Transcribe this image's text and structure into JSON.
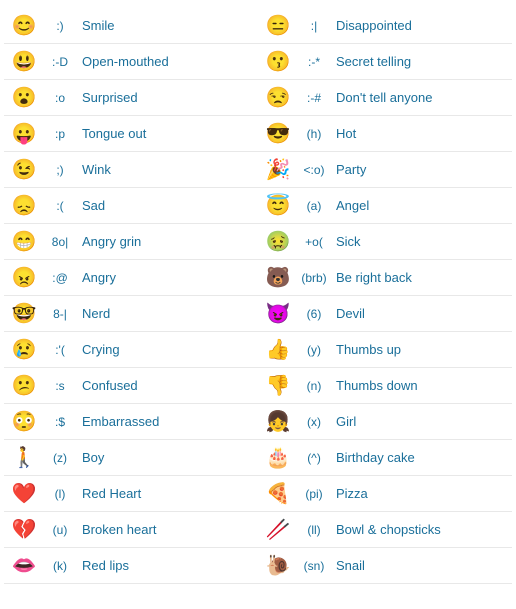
{
  "left": [
    {
      "emoji": "😊",
      "code": ":)",
      "name": "Smile"
    },
    {
      "emoji": "😃",
      "code": ":-D",
      "name": "Open-mouthed"
    },
    {
      "emoji": "😮",
      "code": ":o",
      "name": "Surprised"
    },
    {
      "emoji": "😛",
      "code": ":p",
      "name": "Tongue out"
    },
    {
      "emoji": "😉",
      "code": ";)",
      "name": "Wink"
    },
    {
      "emoji": "😞",
      "code": ":(",
      "name": "Sad"
    },
    {
      "emoji": "😁",
      "code": "8o|",
      "name": "Angry grin"
    },
    {
      "emoji": "😠",
      "code": ":@",
      "name": "Angry"
    },
    {
      "emoji": "🤓",
      "code": "8-|",
      "name": "Nerd"
    },
    {
      "emoji": "😢",
      "code": ":'(",
      "name": "Crying"
    },
    {
      "emoji": "😕",
      "code": ":s",
      "name": "Confused"
    },
    {
      "emoji": "😳",
      "code": ":$",
      "name": "Embarrassed"
    },
    {
      "emoji": "🚶",
      "code": "(z)",
      "name": "Boy"
    },
    {
      "emoji": "❤️",
      "code": "(l)",
      "name": "Red Heart"
    },
    {
      "emoji": "💔",
      "code": "(u)",
      "name": "Broken heart"
    },
    {
      "emoji": "👄",
      "code": "(k)",
      "name": "Red lips"
    }
  ],
  "right": [
    {
      "emoji": "😑",
      "code": ":|",
      "name": "Disappointed"
    },
    {
      "emoji": "😗",
      "code": ":-*",
      "name": "Secret telling"
    },
    {
      "emoji": "😒",
      "code": ":-#",
      "name": "Don't tell anyone"
    },
    {
      "emoji": "😎",
      "code": "(h)",
      "name": "Hot"
    },
    {
      "emoji": "🎉",
      "code": "<:o)",
      "name": "Party"
    },
    {
      "emoji": "😇",
      "code": "(a)",
      "name": "Angel"
    },
    {
      "emoji": "🤢",
      "code": "+o(",
      "name": "Sick"
    },
    {
      "emoji": "🐻",
      "code": "(brb)",
      "name": "Be right back"
    },
    {
      "emoji": "😈",
      "code": "(6)",
      "name": "Devil"
    },
    {
      "emoji": "👍",
      "code": "(y)",
      "name": "Thumbs up"
    },
    {
      "emoji": "👎",
      "code": "(n)",
      "name": "Thumbs down"
    },
    {
      "emoji": "👧",
      "code": "(x)",
      "name": "Girl"
    },
    {
      "emoji": "🎂",
      "code": "(^)",
      "name": "Birthday cake"
    },
    {
      "emoji": "🍕",
      "code": "(pi)",
      "name": "Pizza"
    },
    {
      "emoji": "🥢",
      "code": "(ll)",
      "name": "Bowl & chopsticks"
    },
    {
      "emoji": "🐌",
      "code": "(sn)",
      "name": "Snail"
    }
  ]
}
